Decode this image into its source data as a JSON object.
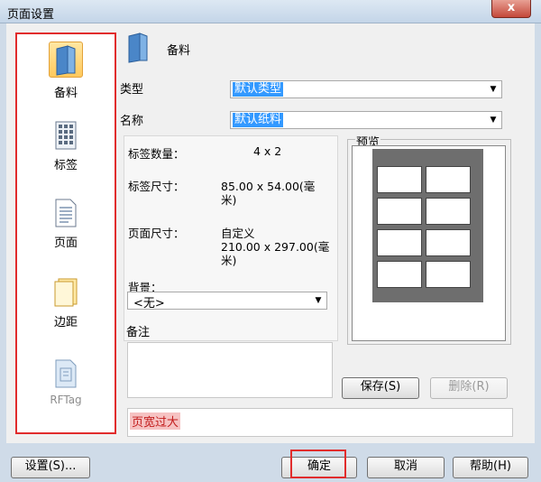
{
  "window": {
    "title": "页面设置",
    "close_glyph": "x"
  },
  "nav": [
    {
      "label": "备料",
      "icon": "document-folder-icon",
      "selected": true
    },
    {
      "label": "标签",
      "icon": "label-grid-icon",
      "selected": false
    },
    {
      "label": "页面",
      "icon": "page-icon",
      "selected": false
    },
    {
      "label": "边距",
      "icon": "margin-pages-icon",
      "selected": false
    },
    {
      "label": "RFTag",
      "icon": "rftag-icon",
      "selected": false,
      "disabled": true
    }
  ],
  "header": {
    "title": "备料",
    "icon": "document-folder-icon"
  },
  "form": {
    "type_label": "类型",
    "type_value": "默认类型",
    "name_label": "名称",
    "name_value": "默认纸料"
  },
  "info": {
    "label_count_label": "标签数量：",
    "label_count_value": "4 x 2",
    "label_size_label": "标签尺寸：",
    "label_size_value_1": "85.00 x 54.00(毫",
    "label_size_value_2": "米)",
    "page_size_label": "页面尺寸：",
    "page_size_value_1": "自定义",
    "page_size_value_2": "210.00 x 297.00(毫",
    "page_size_value_3": "米)",
    "background_label": "背景：",
    "background_value": "<无>"
  },
  "preview": {
    "label": "预览",
    "rows": 4,
    "cols": 2
  },
  "note": {
    "label": "备注"
  },
  "buttons": {
    "save": "保存(S)",
    "delete": "删除(R)",
    "settings": "设置(S)...",
    "ok": "确定",
    "cancel": "取消",
    "help": "帮助(H)"
  },
  "status": {
    "error_text": "页宽过大"
  },
  "colors": {
    "highlight": "#e12c2c",
    "selection": "#3399ff",
    "error_text": "#c21b1b"
  }
}
